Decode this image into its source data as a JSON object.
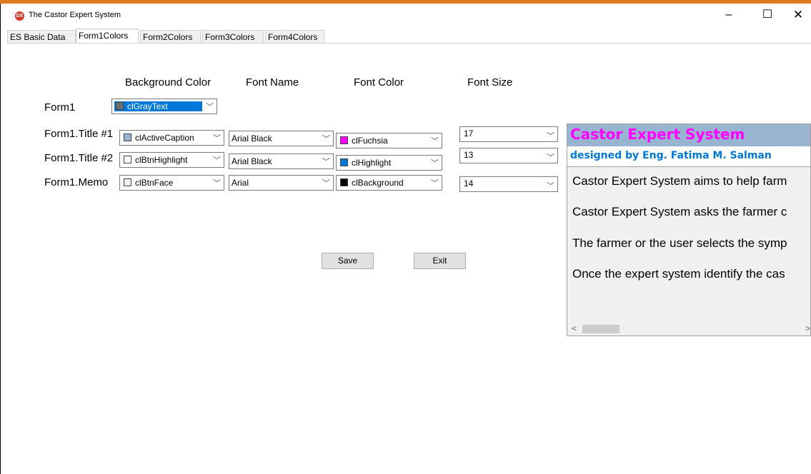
{
  "window": {
    "title": "The Castor Expert System",
    "icon": "castor-app-icon",
    "minimize": "–",
    "maximize": "☐",
    "close": "✕"
  },
  "tabs": [
    {
      "label": "ES Basic Data",
      "active": false
    },
    {
      "label": "Form1Colors",
      "active": true
    },
    {
      "label": "Form2Colors",
      "active": false
    },
    {
      "label": "Form3Colors",
      "active": false
    },
    {
      "label": "Form4Colors",
      "active": false
    }
  ],
  "headers": {
    "background_color": "Background Color",
    "font_name": "Font Name",
    "font_color": "Font Color",
    "font_size": "Font Size"
  },
  "rows": {
    "form1": {
      "label": "Form1",
      "bg_color": "clGrayText",
      "bg_swatch": "#6d6d6d"
    },
    "title1": {
      "label": "Form1.Title #1",
      "bg_color": "clActiveCaption",
      "bg_swatch": "#99b4d1",
      "font_name": "Arial Black",
      "font_color": "clFuchsia",
      "font_swatch": "#ff00ff",
      "font_size": "17"
    },
    "title2": {
      "label": "Form1.Title #2",
      "bg_color": "clBtnHighlight",
      "bg_swatch": "#ffffff",
      "font_name": "Arial Black",
      "font_color": "clHighlight",
      "font_swatch": "#0078d7",
      "font_size": "13"
    },
    "memo": {
      "label": "Form1.Memo",
      "bg_color": "clBtnFace",
      "bg_swatch": "#f0f0f0",
      "font_name": "Arial",
      "font_color": "clBackground",
      "font_swatch": "#000000",
      "font_size": "14"
    }
  },
  "buttons": {
    "save": "Save",
    "exit": "Exit"
  },
  "preview": {
    "title1": "Castor Expert System",
    "title2": "designed by Eng. Fatima M. Salman",
    "memo_lines": [
      "Castor Expert System aims to help farm",
      "Castor Expert System asks the farmer c",
      "The farmer or the user selects the symp",
      "Once the expert system identify the cas"
    ],
    "scroll_left": "<",
    "scroll_right": ">"
  }
}
